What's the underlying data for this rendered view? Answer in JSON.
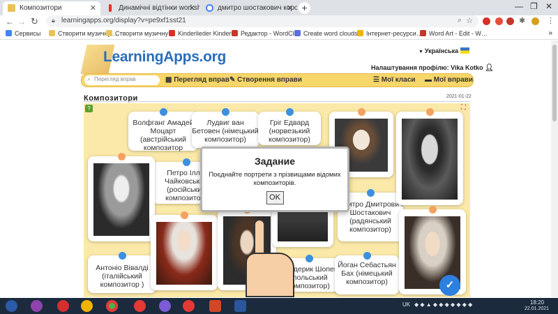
{
  "browser": {
    "tabs": [
      {
        "title": "Композитори",
        "active": true
      },
      {
        "title": "Динамічні відтінки worksheet"
      },
      {
        "title": "дмитро шостакович коротка б…"
      }
    ],
    "url": "learningapps.org/display?v=pe9xf1sst21",
    "bookmarks": [
      "Сервисы",
      "Створити музичну…",
      "Створити музичну…",
      "Kinderlieder Kinder…",
      "Редактор - WordCl…",
      "Create word clouds…",
      "Інтернет-ресурси…",
      "Word Art - Edit - W…"
    ]
  },
  "site": {
    "logo": "LearningApps.org",
    "language": "Українська",
    "profile_settings": "Налаштування профілю: Vika Kotko",
    "search_placeholder": "Перегляд вправ",
    "nav": {
      "browse": "Перегляд вправ",
      "create": "Створення вправи",
      "classes": "Мої класи",
      "my_apps": "Мої вправи"
    },
    "app_title": "Композитори",
    "app_date": "2021-01-22"
  },
  "cards": [
    {
      "id": "mozart",
      "text": "Волфганг Амадей Моцарт (австрійський композитор"
    },
    {
      "id": "beethoven",
      "text": "Лудвиг ван Бетовен (німецький композитор)"
    },
    {
      "id": "grieg",
      "text": "Гріг Едвард (норвезький композитор)"
    },
    {
      "id": "tchaikovsky",
      "text": "Петро Ілліч Чайковський (російський композитор)"
    },
    {
      "id": "shostakovich",
      "text": "Дмитро Дмитрович Шостакович (радянський композитор)"
    },
    {
      "id": "vivaldi",
      "text": "Антоніо Вівалді (італійський композитор )"
    },
    {
      "id": "chopin",
      "text": "Фредерик Шопен (польський композитор)"
    },
    {
      "id": "bach",
      "text": "Йоган Себастьян Бах (німецький композитор)"
    }
  ],
  "modal": {
    "title": "Задание",
    "text": "Поєднайте портрети з прізвищами відомих композиторів.",
    "ok": "OK"
  },
  "taskbar": {
    "lang": "UK",
    "time": "18:20",
    "date": "22.01.2021"
  },
  "colors": {
    "accent": "#f7d66a",
    "board": "#fbe9a9",
    "pin_blue": "#3d8fe0",
    "pin_orange": "#f4a260",
    "logo": "#2a6ebb"
  }
}
